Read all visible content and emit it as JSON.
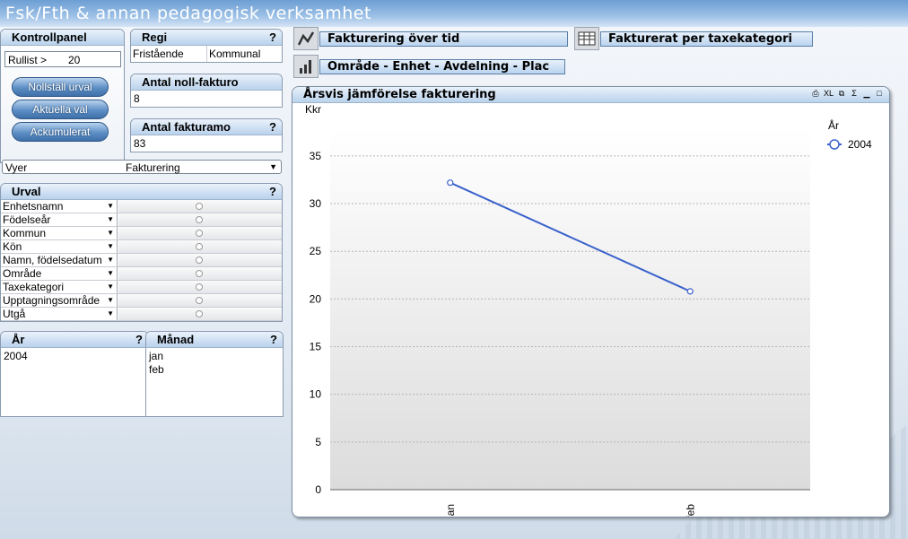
{
  "app": {
    "title": "Fsk/Fth & annan pedagogisk verksamhet"
  },
  "kontrollpanel": {
    "title": "Kontrollpanel",
    "rullist_label": "Rullist >",
    "rullist_value": "20",
    "buttons": [
      "Nollställ urval",
      "Aktuella val",
      "Ackumulerat"
    ]
  },
  "regi": {
    "title": "Regi",
    "help": "?",
    "values": [
      "Fristående",
      "Kommunal"
    ]
  },
  "noll": {
    "title": "Antal noll-fakturo",
    "value": "8"
  },
  "fakturamo": {
    "title": "Antal fakturamo",
    "help": "?",
    "value": "83"
  },
  "tabs": {
    "tab1": "Fakturering över tid",
    "tab2": "Fakturerat per taxekategori",
    "tab3": "Område - Enhet - Avdelning - Plac"
  },
  "vyer": {
    "label": "Vyer",
    "value": "Fakturering"
  },
  "urval": {
    "title": "Urval",
    "help": "?",
    "fields": [
      "Enhetsnamn",
      "Födelseår",
      "Kommun",
      "Kön",
      "Namn, födelsedatum",
      "Område",
      "Taxekategori",
      "Upptagningsområde",
      "Utgå"
    ]
  },
  "ar": {
    "title": "År",
    "help": "?",
    "values": [
      "2004"
    ]
  },
  "manad": {
    "title": "Månad",
    "help": "?",
    "values": [
      "jan",
      "feb"
    ]
  },
  "chart_data": {
    "type": "line",
    "title": "Årsvis jämförelse fakturering",
    "ylabel": "Kkr",
    "xlabel": "",
    "categories": [
      "jan",
      "feb"
    ],
    "series": [
      {
        "name": "2004",
        "values": [
          32.2,
          20.8
        ]
      }
    ],
    "ylim": [
      0,
      38
    ],
    "yticks": [
      0,
      5,
      10,
      15,
      20,
      25,
      30,
      35
    ],
    "legend_title": "År",
    "legend_position": "top-right",
    "grid": true,
    "line_color": "#3a62cc"
  }
}
